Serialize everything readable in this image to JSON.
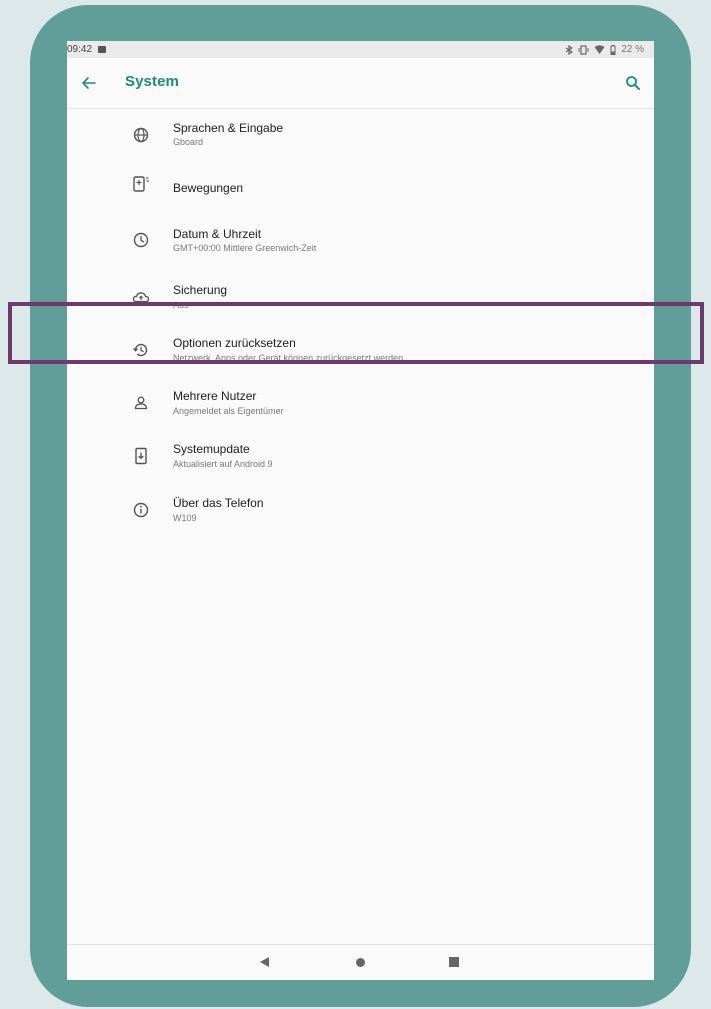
{
  "status_bar": {
    "time": "09:42",
    "battery": "22 %",
    "icons": [
      "image-notification-icon",
      "bluetooth-icon",
      "vibrate-icon",
      "wifi-icon",
      "battery-icon"
    ]
  },
  "app_bar": {
    "title": "System",
    "back_icon": "arrow-left-icon",
    "search_icon": "search-icon"
  },
  "items": [
    {
      "title": "Sprachen & Eingabe",
      "subtitle": "Gboard",
      "icon": "globe-icon"
    },
    {
      "title": "Bewegungen",
      "subtitle": "",
      "icon": "phone-gesture-icon"
    },
    {
      "title": "Datum & Uhrzeit",
      "subtitle": "GMT+00:00 Mittlere Greenwich-Zeit",
      "icon": "clock-icon"
    },
    {
      "title": "Sicherung",
      "subtitle": "Aus",
      "icon": "cloud-upload-icon"
    },
    {
      "title": "Optionen zurücksetzen",
      "subtitle": "Netzwerk, Apps oder Gerät können zurückgesetzt werden",
      "icon": "restore-icon"
    },
    {
      "title": "Mehrere Nutzer",
      "subtitle": "Angemeldet als Eigentümer",
      "icon": "person-icon"
    },
    {
      "title": "Systemupdate",
      "subtitle": "Aktualisiert auf Android 9",
      "icon": "system-update-icon"
    },
    {
      "title": "Über das Telefon",
      "subtitle": "W109",
      "icon": "info-icon"
    }
  ],
  "nav_bar": {
    "back_icon": "nav-back-triangle-icon",
    "home_icon": "nav-home-circle-icon",
    "recents_icon": "nav-recents-square-icon"
  },
  "colors": {
    "accent": "#1e8a80",
    "frame": "#629e99",
    "highlight": "#6e3a6d",
    "background": "#dde8ea"
  }
}
